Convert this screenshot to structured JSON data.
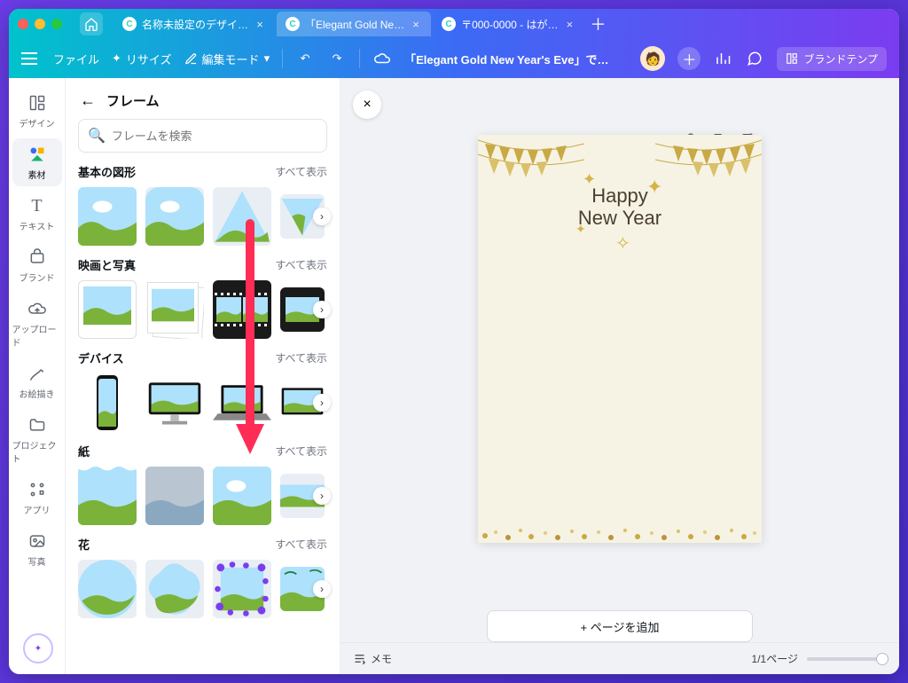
{
  "tabs": [
    {
      "label": "名称未設定のデザイ…",
      "active": false
    },
    {
      "label": "「Elegant Gold Ne…",
      "active": true
    },
    {
      "label": "〒000-0000 - はが…",
      "active": false
    }
  ],
  "toolbar": {
    "file": "ファイル",
    "resize": "リサイズ",
    "edit_mode": "編集モード",
    "doc_title": "「Elegant Gold New Year's Eve」で…",
    "brand_btn": "ブランドテンプ"
  },
  "leftnav": {
    "items": [
      {
        "label": "デザイン",
        "icon": "layout"
      },
      {
        "label": "素材",
        "icon": "shapes",
        "active": true
      },
      {
        "label": "テキスト",
        "icon": "T"
      },
      {
        "label": "ブランド",
        "icon": "cloud"
      },
      {
        "label": "アップロード",
        "icon": "upload"
      },
      {
        "label": "お絵描き",
        "icon": "draw"
      },
      {
        "label": "プロジェクト",
        "icon": "folder"
      },
      {
        "label": "アプリ",
        "icon": "apps"
      },
      {
        "label": "写真",
        "icon": "image"
      }
    ]
  },
  "sidepanel": {
    "title": "フレーム",
    "search_placeholder": "フレームを検索",
    "see_all": "すべて表示",
    "sections": [
      {
        "title": "基本の図形"
      },
      {
        "title": "映画と写真"
      },
      {
        "title": "デバイス"
      },
      {
        "title": "紙"
      },
      {
        "title": "花"
      }
    ]
  },
  "canvas": {
    "happy": "Happy",
    "newyear": "New Year",
    "add_page": "+ ページを追加"
  },
  "bottom": {
    "memo": "メモ",
    "pages": "1/1ページ"
  }
}
